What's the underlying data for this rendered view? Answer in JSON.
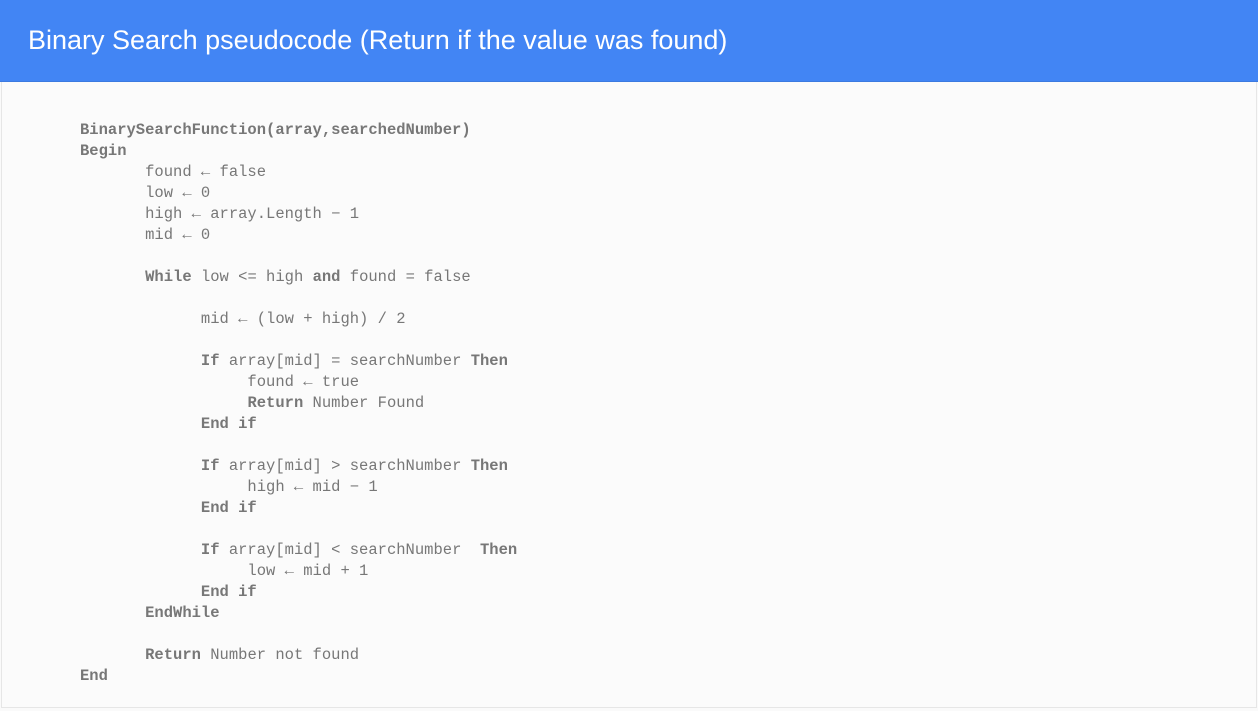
{
  "header": {
    "title": "Binary Search pseudocode  (Return if the value was found)"
  },
  "code": {
    "l0_b": "BinarySearchFunction(array,searchedNumber)",
    "l1_b": "Begin",
    "l2": "       found ← false",
    "l3": "       low ← 0",
    "l4": "       high ← array.Length − 1",
    "l5": "       mid ← 0",
    "blank1": "",
    "l6_pre": "       ",
    "l6_b": "While",
    "l6_mid": " low <= high ",
    "l6_b2": "and",
    "l6_post": " found = false",
    "blank2": "",
    "l7": "             mid ← (low + high) / 2",
    "blank3": "",
    "l8_pre": "             ",
    "l8_b": "If",
    "l8_mid": " array[mid] = searchNumber ",
    "l8_b2": "Then",
    "l9": "                  found ← true",
    "l10_pre": "                  ",
    "l10_b": "Return",
    "l10_post": " Number Found",
    "l11_pre": "             ",
    "l11_b": "End if",
    "blank4": "",
    "l12_pre": "             ",
    "l12_b": "If",
    "l12_mid": " array[mid] > searchNumber ",
    "l12_b2": "Then",
    "l13": "                  high ← mid − 1",
    "l14_pre": "             ",
    "l14_b": "End if",
    "blank5": "",
    "l15_pre": "             ",
    "l15_b": "If",
    "l15_mid": " array[mid] < searchNumber  ",
    "l15_b2": "Then",
    "l16": "                  low ← mid + 1",
    "l17_pre": "             ",
    "l17_b": "End if",
    "l18_pre": "       ",
    "l18_b": "EndWhile",
    "blank6": "",
    "l19_pre": "       ",
    "l19_b": "Return",
    "l19_post": " Number not found",
    "l20_b": "End"
  }
}
